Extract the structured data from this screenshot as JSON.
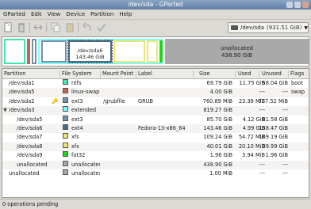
{
  "window": {
    "title": "/dev/sda - GParted"
  },
  "menu": [
    "GParted",
    "Edit",
    "View",
    "Device",
    "Partition",
    "Help"
  ],
  "device": {
    "name": "/dev/sda",
    "size": "(931.51 GiB)"
  },
  "diskmap": {
    "selected": {
      "name": "/dev/sda6",
      "size": "143.46 GiB"
    },
    "unallocated": {
      "name": "unallocated",
      "size": "438.90 GiB"
    }
  },
  "columns": [
    "Partition",
    "File System",
    "Mount Point",
    "Label",
    "Size",
    "Used",
    "Unused",
    "Flags"
  ],
  "rows": [
    {
      "partition": "/dev/sda1",
      "fs": "ntfs",
      "color": "#42e5ac",
      "mount": "",
      "label": "",
      "size": "69.79 GiB",
      "used": "11.75 GiB",
      "unused": "58.04 GiB",
      "flags": "boot"
    },
    {
      "partition": "/dev/sda5",
      "fs": "linux-swap",
      "color": "#c1665a",
      "mount": "",
      "label": "",
      "size": "4.00 GiB",
      "used": "---",
      "unused": "---",
      "flags": "swap"
    },
    {
      "partition": "/dev/sda2",
      "fs": "ext3",
      "color": "#7590ae",
      "mount": "/grubfile",
      "label": "GRUB",
      "size": "760.89 MiB",
      "used": "23.38 MiB",
      "unused": "737.52 MiB",
      "flags": ""
    },
    {
      "partition": "/dev/sda3",
      "fs": "extended",
      "color": "#7dfcfe",
      "mount": "",
      "label": "",
      "size": "819.27 GiB",
      "used": "---",
      "unused": "---",
      "flags": ""
    },
    {
      "partition": "/dev/sda5",
      "fs": "ext3",
      "color": "#7590ae",
      "mount": "",
      "label": "",
      "size": "85.70 GiB",
      "used": "4.12 GiB",
      "unused": "81.58 GiB",
      "flags": ""
    },
    {
      "partition": "/dev/sda6",
      "fs": "ext4",
      "color": "#4b6983",
      "mount": "",
      "label": "Fedora-13-x86_64",
      "size": "143.46 GiB",
      "used": "4.99 GiB",
      "unused": "138.47 GiB",
      "flags": ""
    },
    {
      "partition": "/dev/sda7",
      "fs": "xfs",
      "color": "#eae872",
      "mount": "",
      "label": "",
      "size": "109.24 GiB",
      "used": "54.72 MiB",
      "unused": "109.19 GiB",
      "flags": ""
    },
    {
      "partition": "/dev/sda8",
      "fs": "xfs",
      "color": "#eae872",
      "mount": "",
      "label": "",
      "size": "40.01 GiB",
      "used": "20.10 MiB",
      "unused": "39.99 GiB",
      "flags": ""
    },
    {
      "partition": "/dev/sda9",
      "fs": "fat32",
      "color": "#18d918",
      "mount": "",
      "label": "",
      "size": "1.96 GiB",
      "used": "3.94 MiB",
      "unused": "1.96 GiB",
      "flags": ""
    },
    {
      "partition": "unallocated",
      "fs": "unallocated",
      "color": "#a9a9a9",
      "mount": "",
      "label": "",
      "size": "438.90 GiB",
      "used": "---",
      "unused": "---",
      "flags": ""
    },
    {
      "partition": "unallocated",
      "fs": "unallocated",
      "color": "#a9a9a9",
      "mount": "",
      "label": "",
      "size": "1.00 MiB",
      "used": "---",
      "unused": "---",
      "flags": ""
    }
  ],
  "status": "0 operations pending"
}
